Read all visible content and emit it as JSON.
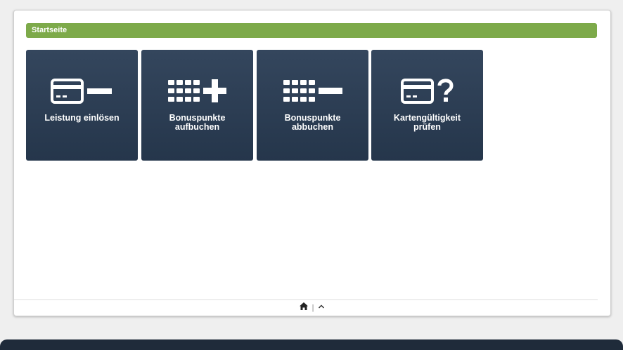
{
  "page": {
    "title": "Startseite"
  },
  "tiles": [
    {
      "label": "Leistung einlösen",
      "icon": "card-minus-icon"
    },
    {
      "label": "Bonuspunkte\naufbuchen",
      "icon": "grid-plus-icon"
    },
    {
      "label": "Bonuspunkte\nabbuchen",
      "icon": "grid-minus-icon"
    },
    {
      "label": "Kartengültigkeit\nprüfen",
      "icon": "card-question-icon"
    }
  ],
  "footer": {
    "separator": "|",
    "home_icon": "home-icon",
    "up_icon": "chevron-up-icon"
  },
  "colors": {
    "title_bar": "#7daa4a",
    "tile": "#2f4157",
    "bottom_bar": "#1f2b3a"
  }
}
